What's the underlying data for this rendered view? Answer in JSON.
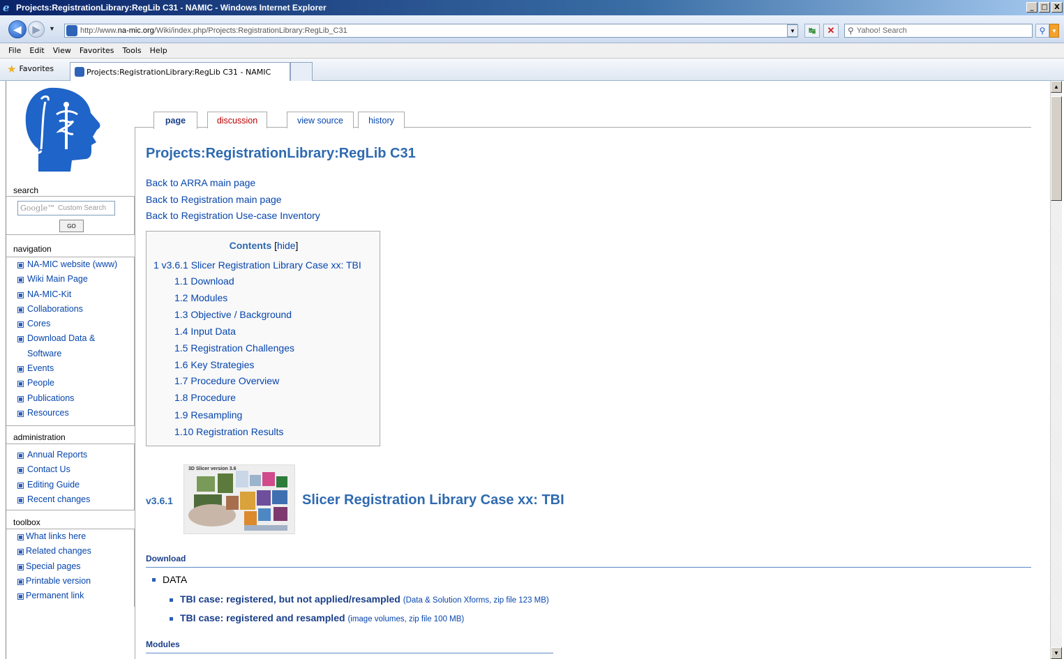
{
  "window": {
    "title": "Projects:RegistrationLibrary:RegLib C31 - NAMIC - Windows Internet Explorer",
    "buttons": {
      "minimize": "_",
      "maximize": "□",
      "close": "X"
    }
  },
  "address_bar": {
    "url_prefix": "http://www.",
    "url_host": "na-mic.org",
    "url_path": "/Wiki/index.php/Projects:RegistrationLibrary:RegLib_C31",
    "search_placeholder": "Yahoo! Search"
  },
  "menu": [
    "File",
    "Edit",
    "View",
    "Favorites",
    "Tools",
    "Help"
  ],
  "favorites_bar": {
    "favorites_label": "Favorites",
    "tab_title": "Projects:RegistrationLibrary:RegLib C31 - NAMIC"
  },
  "sidebar": {
    "search": {
      "heading": "search",
      "google_brand": "Google™",
      "input_placeholder": "Custom Search",
      "go_label": "GO"
    },
    "navigation": {
      "heading": "navigation",
      "items": [
        "NA-MIC website (www)",
        "Wiki Main Page",
        "NA-MIC-Kit",
        "Collaborations",
        "Cores",
        "Download Data &",
        "Software",
        "Events",
        "People",
        "Publications",
        "Resources"
      ]
    },
    "administration": {
      "heading": "administration",
      "items": [
        "Annual Reports",
        "Contact Us",
        "Editing Guide",
        "Recent changes"
      ]
    },
    "toolbox": {
      "heading": "toolbox",
      "items": [
        "What links here",
        "Related changes",
        "Special pages",
        "Printable version",
        "Permanent link"
      ]
    }
  },
  "content_tabs": [
    "page",
    "discussion",
    "view source",
    "history"
  ],
  "article": {
    "title": "Projects:RegistrationLibrary:RegLib C31",
    "back_links": [
      "Back to ARRA main page",
      "Back to Registration main page",
      "Back to Registration Use-case Inventory"
    ],
    "toc": {
      "title": "Contents",
      "hide_open": "[",
      "hide_label": "hide",
      "hide_close": "]",
      "items": [
        "1 v3.6.1 Slicer Registration Library Case xx: TBI",
        "1.1 Download",
        "1.2 Modules",
        "1.3 Objective / Background",
        "1.4 Input Data",
        "1.5 Registration Challenges",
        "1.6 Key Strategies",
        "1.7 Procedure Overview",
        "1.8 Procedure",
        "1.9 Resampling",
        "1.10 Registration Results"
      ]
    },
    "section_version": "v3.6.1",
    "section_image_caption": "3D Slicer version 3.6",
    "section_title": "Slicer Registration Library Case xx: TBI",
    "download_heading": "Download",
    "data_label": "DATA",
    "downloads": [
      {
        "link": "TBI case: registered, but not applied/resampled",
        "note": "(Data & Solution Xforms, zip file 123 MB)"
      },
      {
        "link": "TBI case: registered and resampled",
        "note": "(image volumes, zip file 100 MB)"
      }
    ],
    "modules_heading": "Modules"
  }
}
